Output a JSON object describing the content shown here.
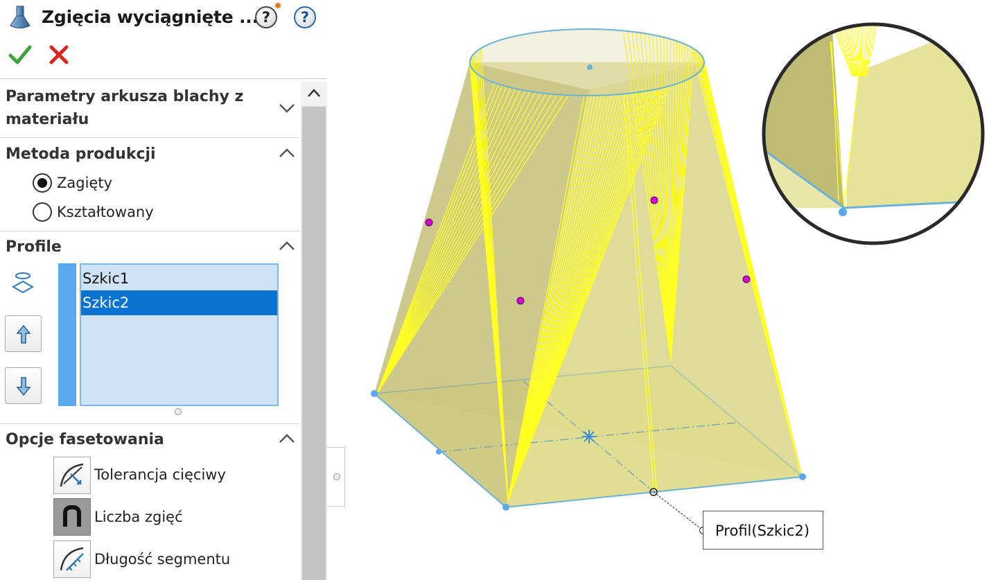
{
  "panel": {
    "title": "Zgięcia wyciągnięte ...",
    "help_whatsnew": "?",
    "help": "?",
    "sections": {
      "sheet_metal": {
        "title_line1": "Parametry arkusza blachy z",
        "title_line2": "materiału"
      },
      "production": {
        "title": "Metoda produkcji",
        "options": [
          {
            "label": "Zagięty",
            "selected": true
          },
          {
            "label": "Kształtowany",
            "selected": false
          }
        ]
      },
      "profiles": {
        "title": "Profile",
        "items": [
          "Szkic1",
          "Szkic2"
        ],
        "selected_index": 1
      },
      "faceting": {
        "title": "Opcje fasetowania",
        "options": [
          {
            "label": "Tolerancja cięciwy",
            "pressed": false
          },
          {
            "label": "Liczba zgięć",
            "pressed": true
          },
          {
            "label": "Długość segmentu",
            "pressed": false
          }
        ]
      }
    }
  },
  "viewport": {
    "callout_label": "Profil(Szkic2)"
  },
  "colors": {
    "accent": "#0a73cf",
    "profile_bar": "#5aa9ee",
    "model_yellow": "#ffff33",
    "model_face": "#cfc97a",
    "edge_blue": "#6ab2d8",
    "point_magenta": "#d400d4"
  }
}
